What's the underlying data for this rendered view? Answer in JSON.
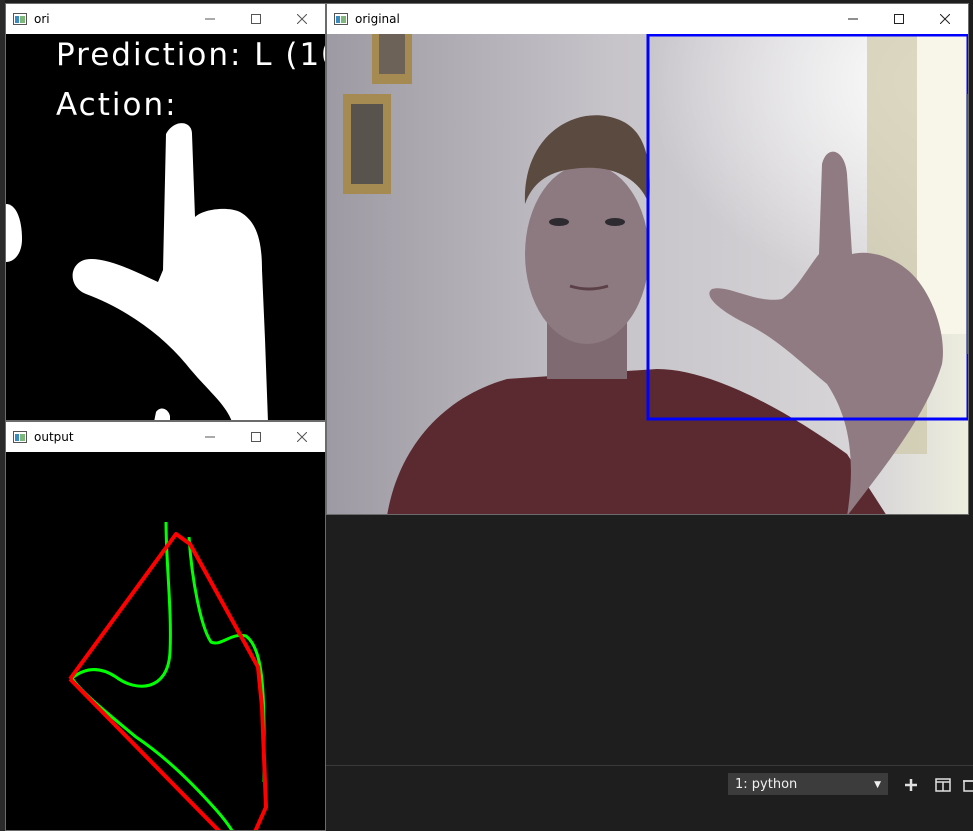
{
  "windows": {
    "ori": {
      "title": "ori",
      "prediction_text": "Prediction: L (10",
      "action_text": "Action:"
    },
    "output": {
      "title": "output"
    },
    "original": {
      "title": "original"
    }
  },
  "terminal": {
    "selected_shell": "1: python",
    "add_icon": "plus-icon",
    "split_icon": "split-editor-icon"
  },
  "colors": {
    "roi_box": "#0000ff",
    "hull_line": "#ff0000",
    "contour_line": "#00ff00",
    "terminal_bg": "#1e1e1e"
  }
}
